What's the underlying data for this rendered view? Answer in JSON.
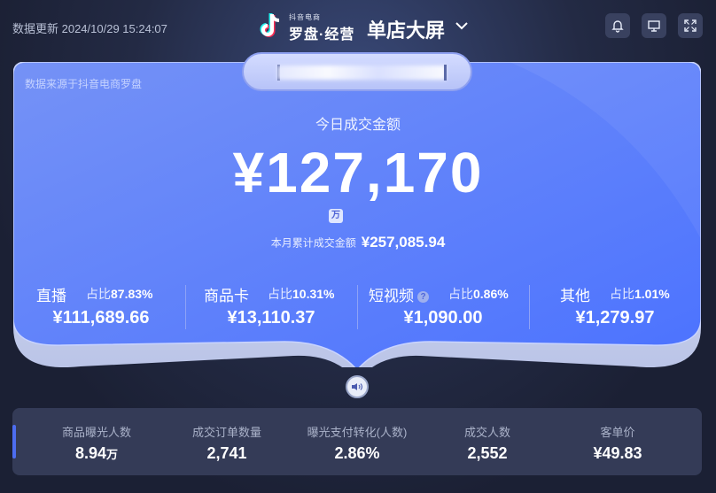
{
  "header": {
    "update_text": "数据更新 2024/10/29 15:24:07",
    "logo_small": "抖音电商",
    "logo_main": "罗盘·经营",
    "store_title": "单店大屏",
    "icons": [
      "bell-icon",
      "monitor-icon",
      "fullscreen-icon"
    ]
  },
  "card": {
    "source_note": "数据来源于抖音电商罗盘",
    "today_label": "今日成交金额",
    "today_value": "¥127,170",
    "today_unit": "万",
    "month_label": "本月累计成交金额",
    "month_value": "¥257,085.94",
    "channels": [
      {
        "name": "直播",
        "share_label": "占比",
        "share": "87.83%",
        "value": "¥111,689.66"
      },
      {
        "name": "商品卡",
        "share_label": "占比",
        "share": "10.31%",
        "value": "¥13,110.37"
      },
      {
        "name": "短视频",
        "share_label": "占比",
        "share": "0.86%",
        "value": "¥1,090.00"
      },
      {
        "name": "其他",
        "share_label": "占比",
        "share": "1.01%",
        "value": "¥1,279.97"
      }
    ]
  },
  "stats": [
    {
      "label": "商品曝光人数",
      "value": "8.94",
      "unit": "万"
    },
    {
      "label": "成交订单数量",
      "value": "2,741",
      "unit": ""
    },
    {
      "label": "曝光支付转化(人数)",
      "value": "2.86%",
      "unit": ""
    },
    {
      "label": "成交人数",
      "value": "2,552",
      "unit": ""
    },
    {
      "label": "客单价",
      "value": "¥49.83",
      "unit": ""
    }
  ],
  "colors": {
    "background": "#1b2034",
    "card_gradient_start": "#6f8df7",
    "card_gradient_end": "#4f74ff",
    "stats_panel": "#343b57",
    "accent": "#4d6df0"
  }
}
